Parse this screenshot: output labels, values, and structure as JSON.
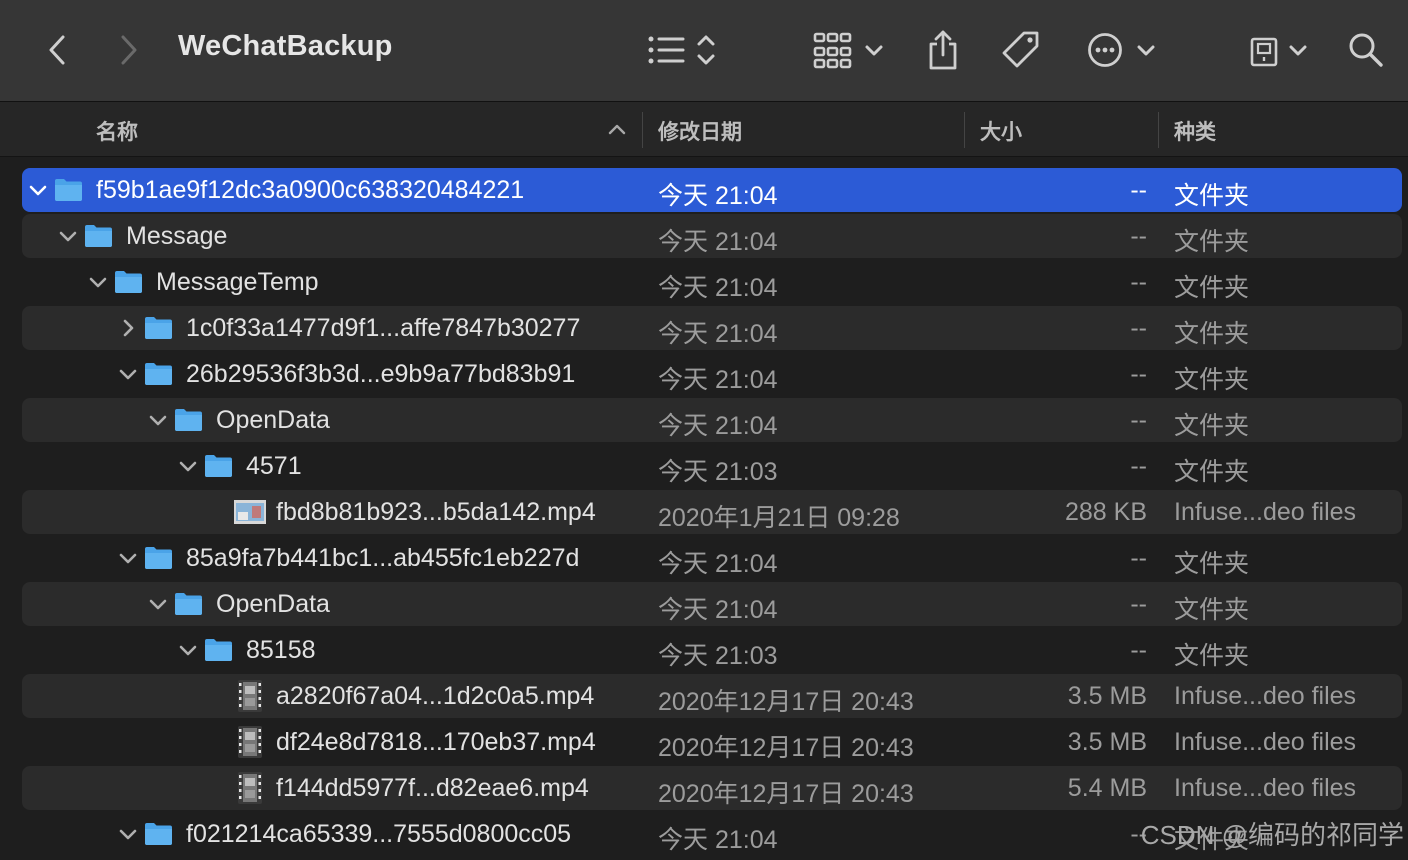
{
  "window": {
    "title": "WeChatBackup",
    "toolbar_icons": [
      "back-icon",
      "forward-icon",
      "list-view-icon",
      "group-grid-icon",
      "share-icon",
      "tag-icon",
      "more-icon",
      "drive-icon",
      "search-icon"
    ]
  },
  "columns": {
    "name": "名称",
    "date": "修改日期",
    "size": "大小",
    "kind": "种类"
  },
  "rows": [
    {
      "name": "f59b1ae9f12dc3a0900c638320484221",
      "date": "今天 21:04",
      "size": "--",
      "kind": "文件夹",
      "depth": 0,
      "type": "folder",
      "expanded": true,
      "selected": true
    },
    {
      "name": "Message",
      "date": "今天 21:04",
      "size": "--",
      "kind": "文件夹",
      "depth": 1,
      "type": "folder",
      "expanded": true
    },
    {
      "name": "MessageTemp",
      "date": "今天 21:04",
      "size": "--",
      "kind": "文件夹",
      "depth": 2,
      "type": "folder",
      "expanded": true
    },
    {
      "name": "1c0f33a1477d9f1...affe7847b30277",
      "date": "今天 21:04",
      "size": "--",
      "kind": "文件夹",
      "depth": 3,
      "type": "folder",
      "expanded": false
    },
    {
      "name": "26b29536f3b3d...e9b9a77bd83b91",
      "date": "今天 21:04",
      "size": "--",
      "kind": "文件夹",
      "depth": 3,
      "type": "folder",
      "expanded": true
    },
    {
      "name": "OpenData",
      "date": "今天 21:04",
      "size": "--",
      "kind": "文件夹",
      "depth": 4,
      "type": "folder",
      "expanded": true
    },
    {
      "name": "4571",
      "date": "今天 21:03",
      "size": "--",
      "kind": "文件夹",
      "depth": 5,
      "type": "folder",
      "expanded": true
    },
    {
      "name": "fbd8b81b923...b5da142.mp4",
      "date": "2020年1月21日 09:28",
      "size": "288 KB",
      "kind": "Infuse...deo files",
      "depth": 6,
      "type": "video-thumb"
    },
    {
      "name": "85a9fa7b441bc1...ab455fc1eb227d",
      "date": "今天 21:04",
      "size": "--",
      "kind": "文件夹",
      "depth": 3,
      "type": "folder",
      "expanded": true
    },
    {
      "name": "OpenData",
      "date": "今天 21:04",
      "size": "--",
      "kind": "文件夹",
      "depth": 4,
      "type": "folder",
      "expanded": true
    },
    {
      "name": "85158",
      "date": "今天 21:03",
      "size": "--",
      "kind": "文件夹",
      "depth": 5,
      "type": "folder",
      "expanded": true
    },
    {
      "name": "a2820f67a04...1d2c0a5.mp4",
      "date": "2020年12月17日 20:43",
      "size": "3.5 MB",
      "kind": "Infuse...deo files",
      "depth": 6,
      "type": "video"
    },
    {
      "name": "df24e8d7818...170eb37.mp4",
      "date": "2020年12月17日 20:43",
      "size": "3.5 MB",
      "kind": "Infuse...deo files",
      "depth": 6,
      "type": "video"
    },
    {
      "name": "f144dd5977f...d82eae6.mp4",
      "date": "2020年12月17日 20:43",
      "size": "5.4 MB",
      "kind": "Infuse...deo files",
      "depth": 6,
      "type": "video"
    },
    {
      "name": "f021214ca65339...7555d0800cc05",
      "date": "今天 21:04",
      "size": "--",
      "kind": "文件夹",
      "depth": 3,
      "type": "folder",
      "expanded": true
    }
  ],
  "colors": {
    "selection": "#2c5bd6",
    "folder": "#4aa3e8",
    "row_alt": "#2b2b2b"
  },
  "watermark": "CSDN @编码的祁同学"
}
